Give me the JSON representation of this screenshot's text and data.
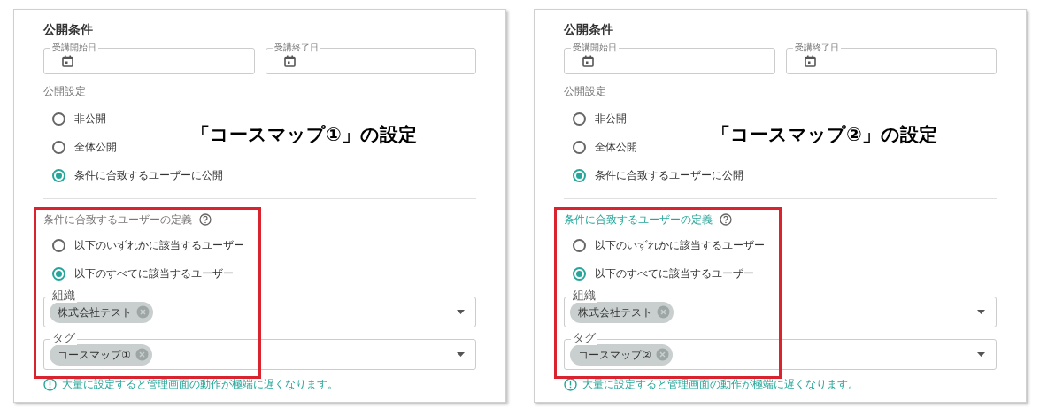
{
  "panels": [
    {
      "title": "公開条件",
      "date_fields": [
        {
          "label": "受講開始日"
        },
        {
          "label": "受講終了日"
        }
      ],
      "publish_label": "公開設定",
      "publish_options": [
        {
          "label": "非公開",
          "selected": false
        },
        {
          "label": "全体公開",
          "selected": false
        },
        {
          "label": "条件に合致するユーザーに公開",
          "selected": true
        }
      ],
      "caption": "「コースマップ①」の設定",
      "definition": {
        "title": "条件に合致するユーザーの定義",
        "focused": false,
        "options": [
          {
            "label": "以下のいずれかに該当するユーザー",
            "selected": false
          },
          {
            "label": "以下のすべてに該当するユーザー",
            "selected": true
          }
        ],
        "fields": [
          {
            "label": "組織",
            "chips": [
              "株式会社テスト"
            ]
          },
          {
            "label": "タグ",
            "chips": [
              "コースマップ①"
            ]
          }
        ]
      },
      "warning": "大量に設定すると管理画面の動作が極端に遅くなります。"
    },
    {
      "title": "公開条件",
      "date_fields": [
        {
          "label": "受講開始日"
        },
        {
          "label": "受講終了日"
        }
      ],
      "publish_label": "公開設定",
      "publish_options": [
        {
          "label": "非公開",
          "selected": false
        },
        {
          "label": "全体公開",
          "selected": false
        },
        {
          "label": "条件に合致するユーザーに公開",
          "selected": true
        }
      ],
      "caption": "「コースマップ②」の設定",
      "definition": {
        "title": "条件に合致するユーザーの定義",
        "focused": true,
        "options": [
          {
            "label": "以下のいずれかに該当するユーザー",
            "selected": false
          },
          {
            "label": "以下のすべてに該当するユーザー",
            "selected": true
          }
        ],
        "fields": [
          {
            "label": "組織",
            "chips": [
              "株式会社テスト"
            ]
          },
          {
            "label": "タグ",
            "chips": [
              "コースマップ②"
            ]
          }
        ]
      },
      "warning": "大量に設定すると管理画面の動作が極端に遅くなります。"
    }
  ]
}
